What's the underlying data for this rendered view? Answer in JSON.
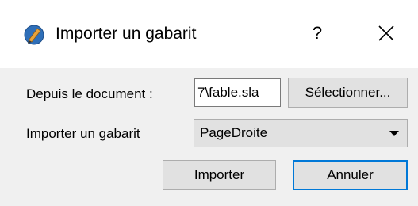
{
  "window": {
    "title": "Importer un gabarit",
    "app_icon": "scribus-pen-icon",
    "help_label": "?",
    "close_icon": "close-icon"
  },
  "form": {
    "document_label": "Depuis le document :",
    "document_value": "7\\fable.sla",
    "select_button_label": "Sélectionner...",
    "template_label": "Importer un gabarit",
    "template_selected": "PageDroite"
  },
  "buttons": {
    "import_label": "Importer",
    "cancel_label": "Annuler"
  },
  "colors": {
    "focus_border": "#0078d7",
    "button_face": "#e1e1e1",
    "dialog_background": "#f0f0f0"
  }
}
